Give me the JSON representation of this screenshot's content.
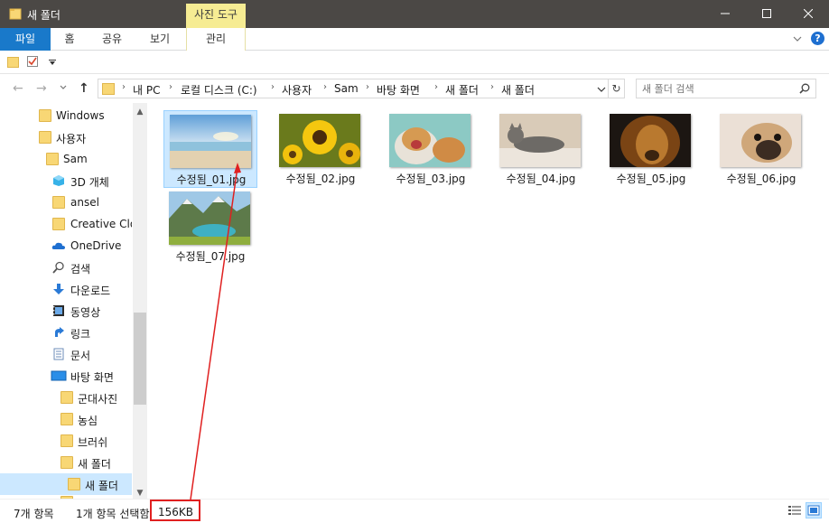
{
  "window": {
    "title": "새 폴더",
    "context_tab": "사진 도구",
    "controls": [
      "minimize-icon",
      "maximize-icon",
      "close-icon"
    ]
  },
  "ribbon": {
    "tabs": [
      "파일",
      "홈",
      "공유",
      "보기",
      "관리"
    ]
  },
  "address": {
    "crumbs": [
      "내 PC",
      "로컬 디스크 (C:)",
      "사용자",
      "Sam",
      "바탕 화면",
      "새 폴더",
      "새 폴더"
    ]
  },
  "search": {
    "placeholder": "새 폴더 검색"
  },
  "sidebar": {
    "items": [
      {
        "label": "Windows",
        "icon": "folder-icon"
      },
      {
        "label": "사용자",
        "icon": "folder-icon"
      },
      {
        "label": "Sam",
        "icon": "folder-icon"
      },
      {
        "label": "3D 개체",
        "icon": "cube-icon"
      },
      {
        "label": "ansel",
        "icon": "folder-icon"
      },
      {
        "label": "Creative Clou",
        "icon": "folder-icon"
      },
      {
        "label": "OneDrive",
        "icon": "cloud-icon"
      },
      {
        "label": "검색",
        "icon": "search-icon"
      },
      {
        "label": "다운로드",
        "icon": "download-icon"
      },
      {
        "label": "동영상",
        "icon": "video-icon"
      },
      {
        "label": "링크",
        "icon": "link-icon"
      },
      {
        "label": "문서",
        "icon": "document-icon"
      },
      {
        "label": "바탕 화면",
        "icon": "desktop-icon"
      },
      {
        "label": "군대사진",
        "icon": "folder-icon"
      },
      {
        "label": "농심",
        "icon": "folder-icon"
      },
      {
        "label": "브러쉬",
        "icon": "folder-icon"
      },
      {
        "label": "새 폴더",
        "icon": "folder-icon"
      },
      {
        "label": "새 폴더",
        "icon": "folder-icon"
      }
    ]
  },
  "files": [
    {
      "name": "수정됨_01.jpg",
      "selected": true
    },
    {
      "name": "수정됨_02.jpg",
      "selected": false
    },
    {
      "name": "수정됨_03.jpg",
      "selected": false
    },
    {
      "name": "수정됨_04.jpg",
      "selected": false
    },
    {
      "name": "수정됨_05.jpg",
      "selected": false
    },
    {
      "name": "수정됨_06.jpg",
      "selected": false
    },
    {
      "name": "수정됨_07.jpg",
      "selected": false
    }
  ],
  "status": {
    "count": "7개 항목",
    "selection": "1개 항목 선택함",
    "size": "156KB"
  },
  "colors": {
    "titlebar": "#4b4845",
    "file_tab": "#1979ca",
    "context_tab": "#f6ec93",
    "selection": "#cce8ff",
    "highlight": "#e02020"
  }
}
